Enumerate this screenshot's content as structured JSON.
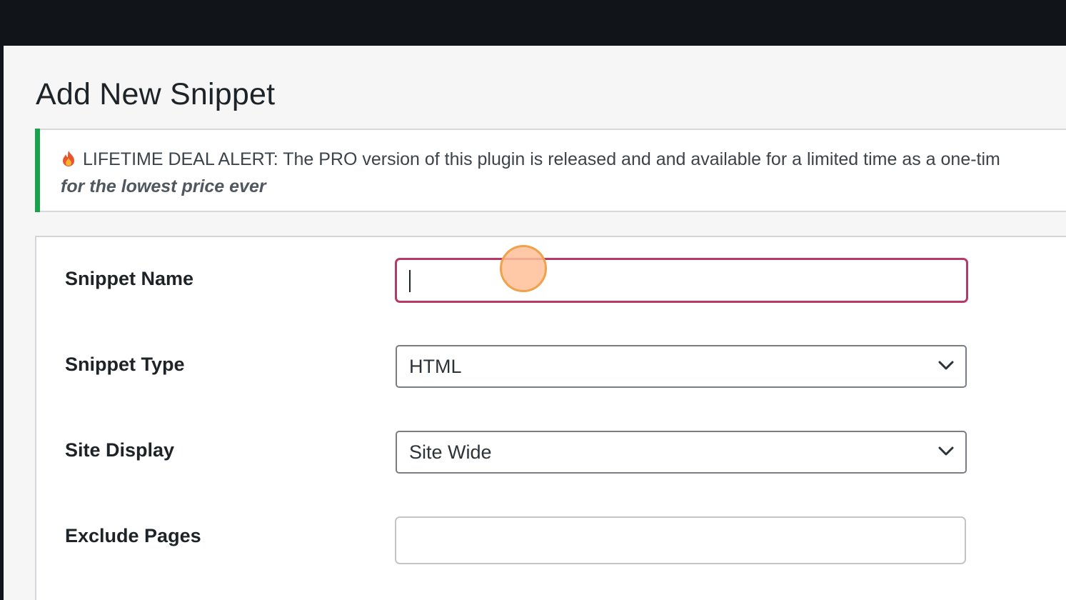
{
  "page": {
    "title": "Add New Snippet"
  },
  "notice": {
    "icon": "fire-icon",
    "line1": "LIFETIME DEAL ALERT: The PRO version of this plugin is released and and available for a limited time as a one-tim",
    "line2": "for the lowest price ever",
    "accent_color": "#16a34a"
  },
  "form": {
    "snippet_name": {
      "label": "Snippet Name",
      "value": "",
      "focused": true,
      "focus_color": "#b83867"
    },
    "snippet_type": {
      "label": "Snippet Type",
      "selected": "HTML",
      "icon": "chevron-down-icon"
    },
    "site_display": {
      "label": "Site Display",
      "selected": "Site Wide",
      "icon": "chevron-down-icon"
    },
    "exclude_pages": {
      "label": "Exclude Pages",
      "value": ""
    }
  },
  "pointer": {
    "icon": "click-indicator",
    "color": "#f0a24a"
  }
}
